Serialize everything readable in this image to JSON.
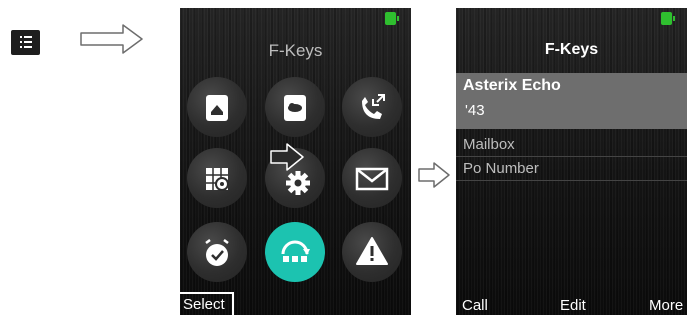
{
  "left_panel": {
    "menu_key_icon": "menu-list-icon",
    "arrow_icon": "right-outline-arrow-icon"
  },
  "main_menu": {
    "title": "F-Keys",
    "battery_color": "#2fbf2f",
    "highlight_color": "#1cc3b0",
    "icons": [
      "contacts-book-icon",
      "local-phonebook-icon",
      "call-log-icon",
      "settings-grid-icon",
      "settings-gear-icon",
      "message-envelope-icon",
      "alarm-clock-icon",
      "f-keys-icon",
      "warning-icon"
    ],
    "softkey_left": "Select"
  },
  "fkeys_screen": {
    "title": "F-Keys",
    "items": [
      {
        "name": "Asterix Echo",
        "number": "'43"
      },
      {
        "name": "Mailbox"
      },
      {
        "name": "Po Number"
      }
    ],
    "softkeys": {
      "left": "Call",
      "center": "Edit",
      "right": "More"
    }
  }
}
